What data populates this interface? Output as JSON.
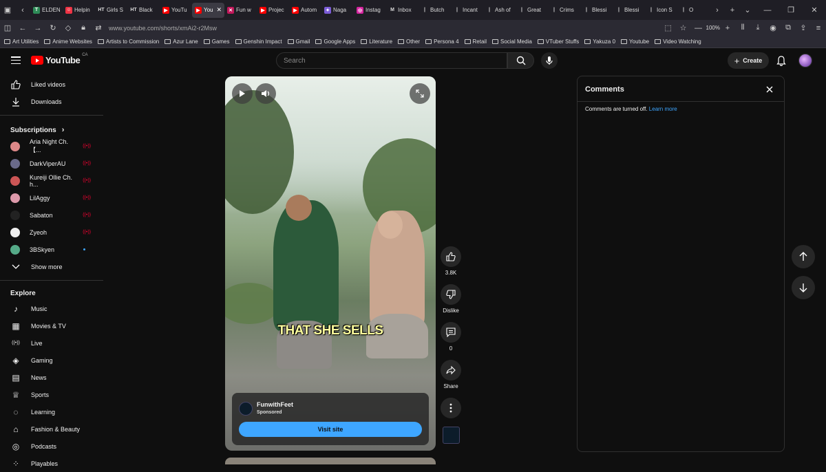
{
  "browser": {
    "tabs": [
      {
        "label": "ELDEN",
        "color": "#2e8b57",
        "glyph": "T"
      },
      {
        "label": "Helpin",
        "color": "#e34",
        "glyph": "☺"
      },
      {
        "label": "Girls S",
        "color": "",
        "glyph": "HT"
      },
      {
        "label": "Black",
        "color": "",
        "glyph": "HT"
      },
      {
        "label": "YouTu",
        "color": "#f00",
        "glyph": "▶"
      },
      {
        "label": "You",
        "color": "#f00",
        "glyph": "▶",
        "active": true
      },
      {
        "label": "Fun w",
        "color": "#c2185b",
        "glyph": "✕"
      },
      {
        "label": "Projec",
        "color": "#f00",
        "glyph": "▶"
      },
      {
        "label": "Autom",
        "color": "#f00",
        "glyph": "▶"
      },
      {
        "label": "Naga",
        "color": "#7b5cd6",
        "glyph": "✦"
      },
      {
        "label": "Instag",
        "color": "#d6249f",
        "glyph": "◎"
      },
      {
        "label": "Inbox",
        "color": "",
        "glyph": "M"
      },
      {
        "label": "Butch",
        "color": "",
        "glyph": "|"
      },
      {
        "label": "Incant",
        "color": "",
        "glyph": "|"
      },
      {
        "label": "Ash of",
        "color": "",
        "glyph": "|"
      },
      {
        "label": "Great",
        "color": "",
        "glyph": "|"
      },
      {
        "label": "Crims",
        "color": "",
        "glyph": "|"
      },
      {
        "label": "Blessi",
        "color": "",
        "glyph": "|"
      },
      {
        "label": "Blessi",
        "color": "",
        "glyph": "|"
      },
      {
        "label": "Icon S",
        "color": "",
        "glyph": "|"
      },
      {
        "label": "O",
        "color": "",
        "glyph": "|"
      }
    ],
    "url": "www.youtube.com/shorts/xmAi2-r2Msw",
    "zoom": "100%",
    "bookmarks": [
      "Art Utilities",
      "Anime Websites",
      "Artists to Commission",
      "Azur Lane",
      "Games",
      "Genshin Impact",
      "Gmail",
      "Google Apps",
      "Literature",
      "Other",
      "Persona 4",
      "Retail",
      "Social Media",
      "VTuber Stuffs",
      "Yakuza 0",
      "Youtube",
      "Video Watching"
    ]
  },
  "header": {
    "logo_text": "YouTube",
    "region": "CA",
    "search_placeholder": "Search",
    "create_label": "Create"
  },
  "sidebar": {
    "top_items": [
      {
        "label": "Liked videos",
        "icon": "thumbs-up-icon"
      },
      {
        "label": "Downloads",
        "icon": "download-icon"
      }
    ],
    "subscriptions_title": "Subscriptions",
    "subscriptions": [
      {
        "label": "Aria Night Ch. 【...",
        "live": true,
        "color": "#d88"
      },
      {
        "label": "DarkViperAU",
        "live": true,
        "color": "#6a6a8a"
      },
      {
        "label": "Kureiji Ollie Ch. h...",
        "live": true,
        "color": "#c55"
      },
      {
        "label": "LilAggy",
        "live": true,
        "color": "#d9a"
      },
      {
        "label": "Sabaton",
        "live": true,
        "color": "#222"
      },
      {
        "label": "Zyeoh",
        "live": true,
        "color": "#eee"
      },
      {
        "label": "3BSkyen",
        "live": false,
        "color": "#5a8"
      }
    ],
    "show_more": "Show more",
    "explore_title": "Explore",
    "explore_items": [
      {
        "label": "Music",
        "icon": "music-icon"
      },
      {
        "label": "Movies & TV",
        "icon": "film-icon"
      },
      {
        "label": "Live",
        "icon": "live-icon"
      },
      {
        "label": "Gaming",
        "icon": "gaming-icon"
      },
      {
        "label": "News",
        "icon": "news-icon"
      },
      {
        "label": "Sports",
        "icon": "trophy-icon"
      },
      {
        "label": "Learning",
        "icon": "bulb-icon"
      },
      {
        "label": "Fashion & Beauty",
        "icon": "hanger-icon"
      },
      {
        "label": "Podcasts",
        "icon": "podcast-icon"
      },
      {
        "label": "Playables",
        "icon": "playables-icon"
      }
    ]
  },
  "short": {
    "caption": "THAT SHE SELLS",
    "advertiser": "FunwithFeet",
    "sponsored": "Sponsored",
    "visit_label": "Visit site"
  },
  "actions": {
    "likes": "3.8K",
    "dislike_label": "Dislike",
    "comments_count": "0",
    "share_label": "Share"
  },
  "comments": {
    "title": "Comments",
    "message": "Comments are turned off.",
    "link": "Learn more"
  }
}
